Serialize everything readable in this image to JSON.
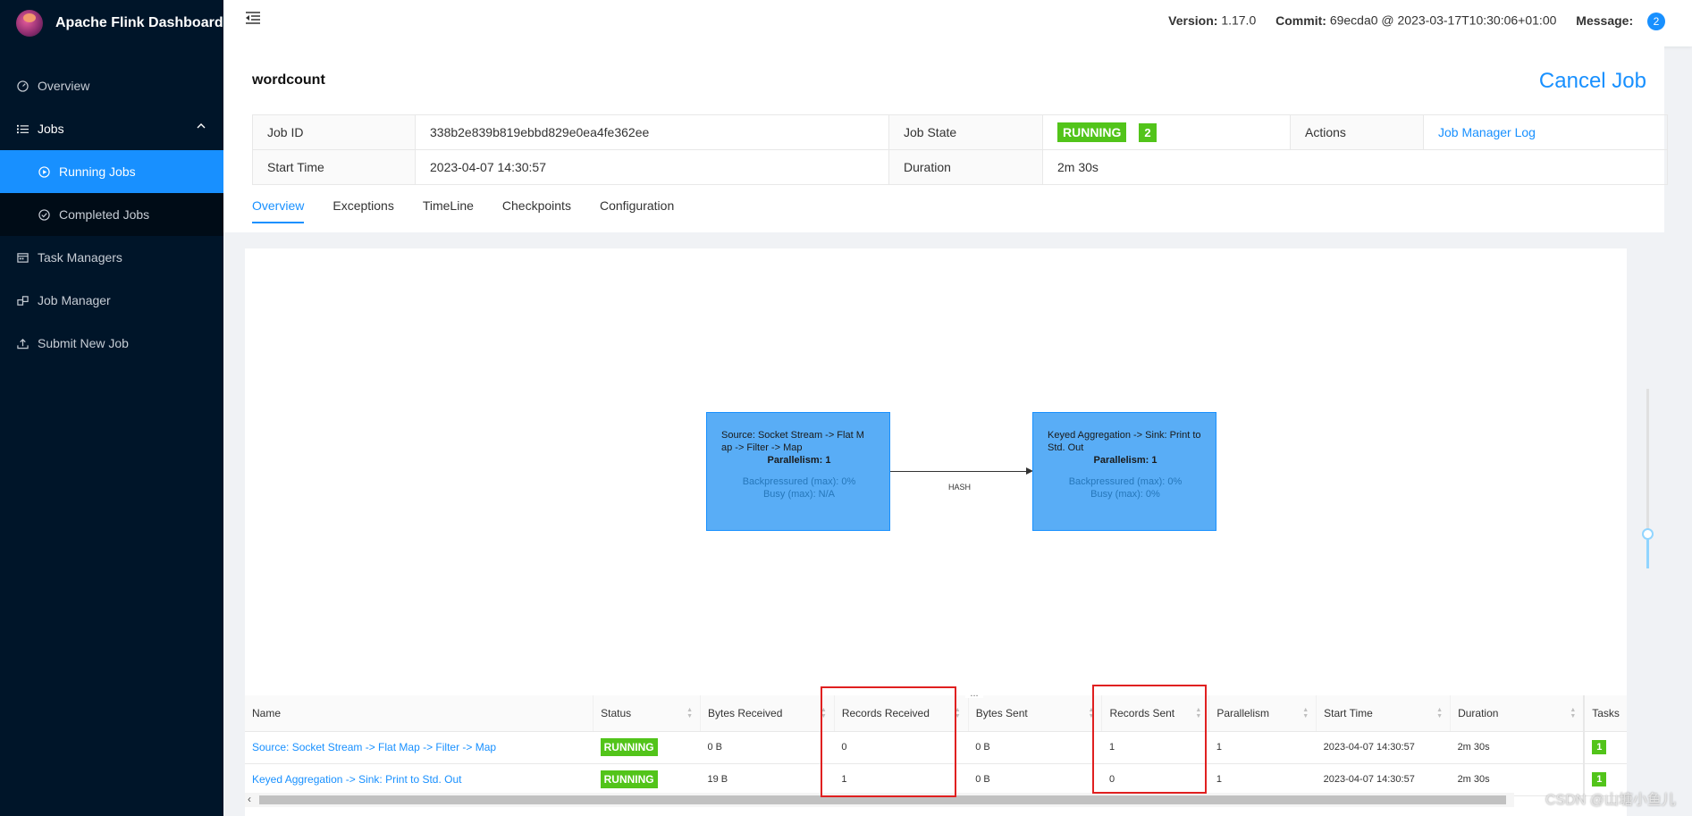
{
  "app": {
    "title": "Apache Flink Dashboard",
    "version_label": "Version:",
    "version": "1.17.0",
    "commit_label": "Commit:",
    "commit": "69ecda0 @ 2023-03-17T10:30:06+01:00",
    "message_label": "Message:",
    "message_count": "2"
  },
  "sidebar": {
    "items": [
      {
        "label": "Overview",
        "icon": "dashboard-icon"
      },
      {
        "label": "Jobs",
        "icon": "list-icon"
      },
      {
        "label": "Running Jobs",
        "icon": "play-circle-icon"
      },
      {
        "label": "Completed Jobs",
        "icon": "check-circle-icon"
      },
      {
        "label": "Task Managers",
        "icon": "schedule-icon"
      },
      {
        "label": "Job Manager",
        "icon": "build-icon"
      },
      {
        "label": "Submit New Job",
        "icon": "upload-icon"
      }
    ]
  },
  "job": {
    "name": "wordcount",
    "cancel_label": "Cancel Job",
    "id_label": "Job ID",
    "id": "338b2e839b819ebbd829e0ea4fe362ee",
    "state_label": "Job State",
    "state": "RUNNING",
    "state_count": "2",
    "actions_label": "Actions",
    "action_link": "Job Manager Log",
    "start_label": "Start Time",
    "start": "2023-04-07 14:30:57",
    "duration_label": "Duration",
    "duration": "2m 30s"
  },
  "tabs": [
    "Overview",
    "Exceptions",
    "TimeLine",
    "Checkpoints",
    "Configuration"
  ],
  "graph": {
    "nodes": [
      {
        "name": "Source: Socket Stream -> Flat M ap -> Filter -> Map",
        "parallelism": "Parallelism: 1",
        "backpressured": "Backpressured (max): 0%",
        "busy": "Busy (max): N/A"
      },
      {
        "name": "Keyed Aggregation -> Sink: Print to Std. Out",
        "parallelism": "Parallelism: 1",
        "backpressured": "Backpressured (max): 0%",
        "busy": "Busy (max): 0%"
      }
    ],
    "edge_label": "HASH"
  },
  "vertex_table": {
    "resizer": "...",
    "columns": [
      "Name",
      "Status",
      "Bytes Received",
      "Records Received",
      "Bytes Sent",
      "Records Sent",
      "Parallelism",
      "Start Time",
      "Duration",
      "Tasks"
    ],
    "rows": [
      {
        "name": "Source: Socket Stream -> Flat Map -> Filter -> Map",
        "status": "RUNNING",
        "bytes_received": "0 B",
        "records_received": "0",
        "bytes_sent": "0 B",
        "records_sent": "1",
        "parallelism": "1",
        "start_time": "2023-04-07 14:30:57",
        "duration": "2m 30s",
        "tasks": "1"
      },
      {
        "name": "Keyed Aggregation -> Sink: Print to Std. Out",
        "status": "RUNNING",
        "bytes_received": "19 B",
        "records_received": "1",
        "bytes_sent": "0 B",
        "records_sent": "0",
        "parallelism": "1",
        "start_time": "2023-04-07 14:30:57",
        "duration": "2m 30s",
        "tasks": "1"
      }
    ]
  },
  "watermark": "CSDN @山塘小鱼儿",
  "colors": {
    "sidebar_bg": "#001529",
    "accent": "#1890ff",
    "running": "#52c41a",
    "node_fill": "#59adf6",
    "annotation": "#e02020"
  }
}
